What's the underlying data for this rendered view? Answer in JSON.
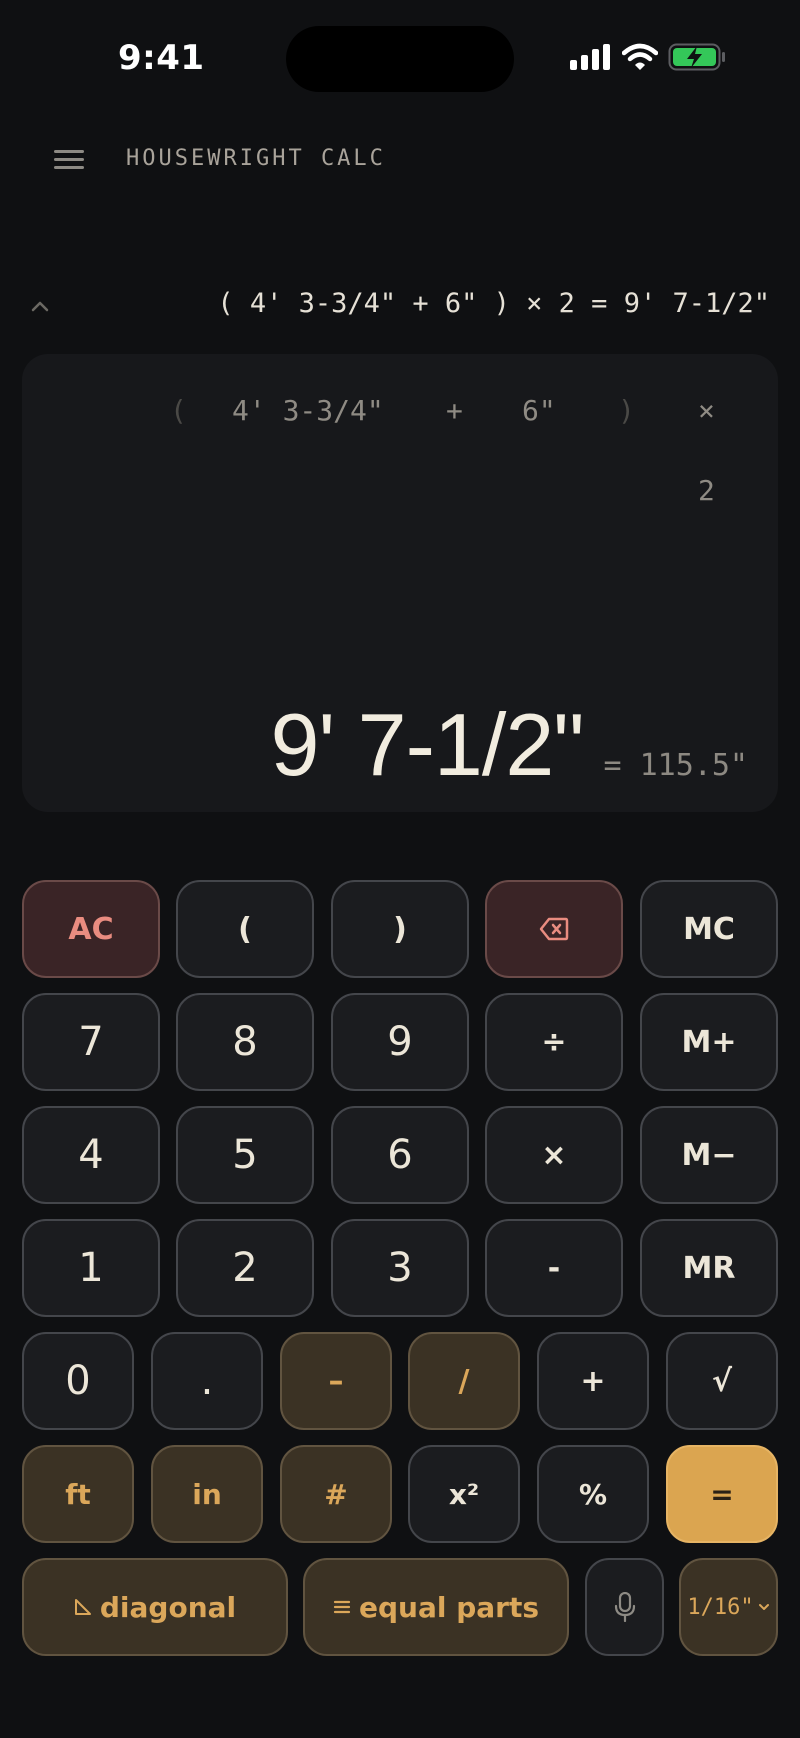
{
  "status_bar": {
    "time": "9:41"
  },
  "header": {
    "title": "HOUSEWRIGHT CALC"
  },
  "tape": {
    "expression": "( 4' 3-3/4\" + 6\" ) × 2 = 9' 7-1/2\""
  },
  "display": {
    "tokens": [
      {
        "text": "(",
        "dim": true
      },
      {
        "text": "4' 3-3/4\"",
        "dim": false
      },
      {
        "text": "+",
        "dim": false
      },
      {
        "text": "6\"",
        "dim": false
      },
      {
        "text": ")",
        "dim": true
      },
      {
        "text": "×",
        "dim": false
      },
      {
        "text": "2",
        "dim": false
      }
    ],
    "result": "9' 7-1/2\"",
    "result_decimal": "= 115.5\""
  },
  "keypad": {
    "rows": [
      [
        "AC",
        "(",
        ")",
        "backspace",
        "MC"
      ],
      [
        "7",
        "8",
        "9",
        "÷",
        "M+"
      ],
      [
        "4",
        "5",
        "6",
        "×",
        "M−"
      ],
      [
        "1",
        "2",
        "3",
        "-",
        "MR"
      ],
      [
        "0",
        ".",
        "–",
        "/",
        "+",
        "√"
      ],
      [
        "ft",
        "in",
        "#",
        "x²",
        "%",
        "="
      ]
    ],
    "diagonal_label": "diagonal",
    "equal_parts_label": "equal parts",
    "precision_label": "1/16\""
  },
  "colors": {
    "background": "#0f1012",
    "accent": "#dba550",
    "danger": "#e98c80",
    "unit_key": "#3b3224"
  }
}
